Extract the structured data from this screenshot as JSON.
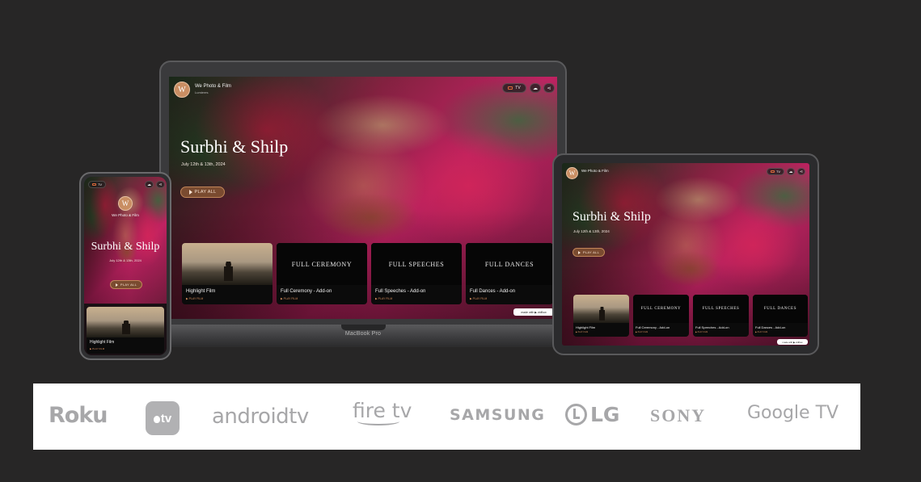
{
  "app": {
    "studio_name": "We Photo & Film",
    "studio_sub": "Lumieres",
    "logo_letter": "W",
    "tv_label": "TV",
    "couple_title": "Surbhi & Shilp",
    "date": "July 12th & 13th, 2024",
    "play_all": "PLAY ALL",
    "made_with": "made with ▶ vidflow",
    "cards": [
      {
        "thumb_title": "",
        "label": "Highlight Film",
        "play": "▶ PLAY FILM"
      },
      {
        "thumb_title": "FULL CEREMONY",
        "label": "Full Ceremony - Add-on",
        "play": "▶ PLAY FILM"
      },
      {
        "thumb_title": "FULL SPEECHES",
        "label": "Full Speeches - Add-on",
        "play": "▶ PLAY FILM"
      },
      {
        "thumb_title": "FULL DANCES",
        "label": "Full Dances - Add-on",
        "play": "▶ PLAY FILM"
      }
    ]
  },
  "laptop": {
    "model_label": "MacBook Pro"
  },
  "platforms": {
    "roku": "Roku",
    "appletv": "tv",
    "androidtv": "androidtv",
    "firetv": "fire tv",
    "samsung": "SAMSUNG",
    "lg": "LG",
    "sony": "SONY",
    "googletv": "Google TV"
  },
  "colors": {
    "background": "#272626",
    "accent": "#c98e63",
    "play_button": "#7a4b30",
    "logo_gray": "#a7a7a9"
  }
}
